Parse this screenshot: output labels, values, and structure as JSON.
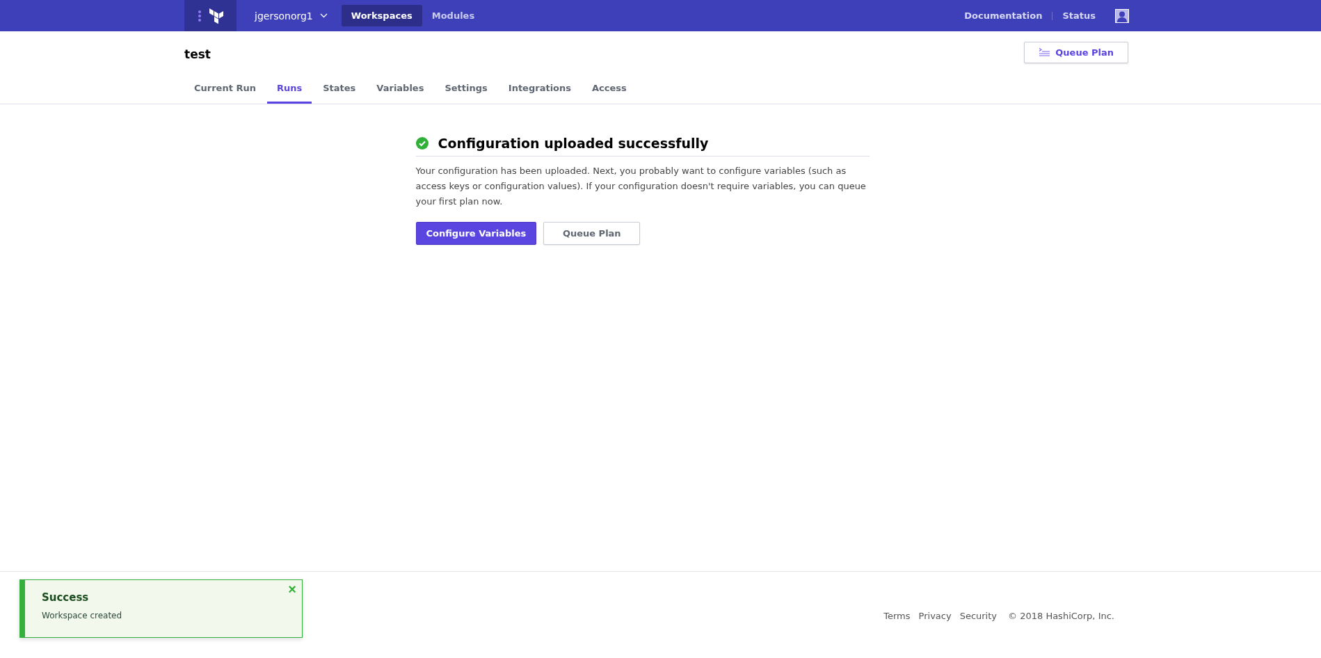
{
  "top_nav": {
    "org": "jgersonorg1",
    "links": [
      {
        "label": "Workspaces",
        "selected": true
      },
      {
        "label": "Modules",
        "selected": false
      }
    ],
    "right_links": [
      "Documentation",
      "Status"
    ]
  },
  "workspace": {
    "name": "test",
    "action": "Queue Plan"
  },
  "tabs": [
    {
      "label": "Current Run",
      "selected": false
    },
    {
      "label": "Runs",
      "selected": true
    },
    {
      "label": "States",
      "selected": false
    },
    {
      "label": "Variables",
      "selected": false
    },
    {
      "label": "Settings",
      "selected": false
    },
    {
      "label": "Integrations",
      "selected": false
    },
    {
      "label": "Access",
      "selected": false
    }
  ],
  "message": {
    "title": "Configuration uploaded successfully",
    "body": "Your configuration has been uploaded. Next, you probably want to configure variables (such as access keys or configuration values). If your configuration doesn't require variables, you can queue your first plan now.",
    "buttons": [
      {
        "label": "Configure Variables",
        "kind": "primary"
      },
      {
        "label": "Queue Plan",
        "kind": "secondary"
      }
    ]
  },
  "toast": {
    "title": "Success",
    "text": "Workspace created",
    "close": "×"
  },
  "footer": {
    "links": [
      "Terms",
      "Privacy",
      "Security"
    ],
    "copyright": "© 2018 HashiCorp, Inc."
  }
}
